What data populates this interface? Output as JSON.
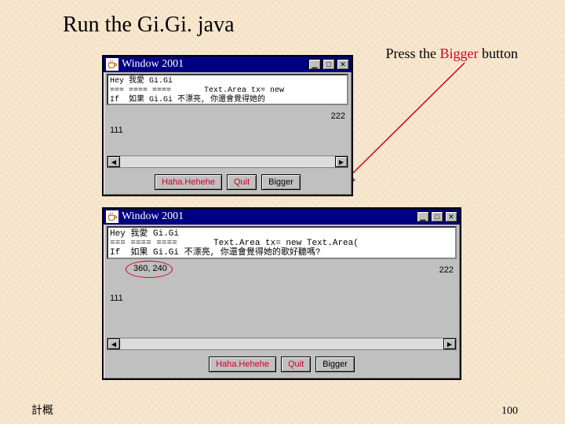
{
  "slide": {
    "title": "Run the Gi.Gi. java",
    "annotation_pre": "Press the ",
    "annotation_red": "Bigger",
    "annotation_post": " button",
    "footer_left": "計概",
    "page_num": "100"
  },
  "win1": {
    "title": "Window 2001",
    "text": "Hey 我愛 Gi.Gi\n=== ==== ====       Text.Area tx= new \nIf  如果 Gi.Gi 不漂亮, 你還會覺得她的",
    "label_left": "111",
    "label_right": "222",
    "buttons": {
      "haha": "Haha.Hehehe",
      "quit": "Quit",
      "bigger": "Bigger"
    }
  },
  "win2": {
    "title": "Window 2001",
    "text": "Hey 我愛 Gi.Gi\n=== ==== ====       Text.Area tx= new Text.Area(\nIf  如果 Gi.Gi 不漂亮, 你還會覺得她的歌好聽嗎?",
    "coord": "360, 240",
    "label_left": "111",
    "label_right": "222",
    "buttons": {
      "haha": "Haha.Hehehe",
      "quit": "Quit",
      "bigger": "Bigger"
    }
  },
  "icons": {
    "min": "▁",
    "max": "□",
    "close": "✕",
    "left": "◀",
    "right": "▶"
  }
}
